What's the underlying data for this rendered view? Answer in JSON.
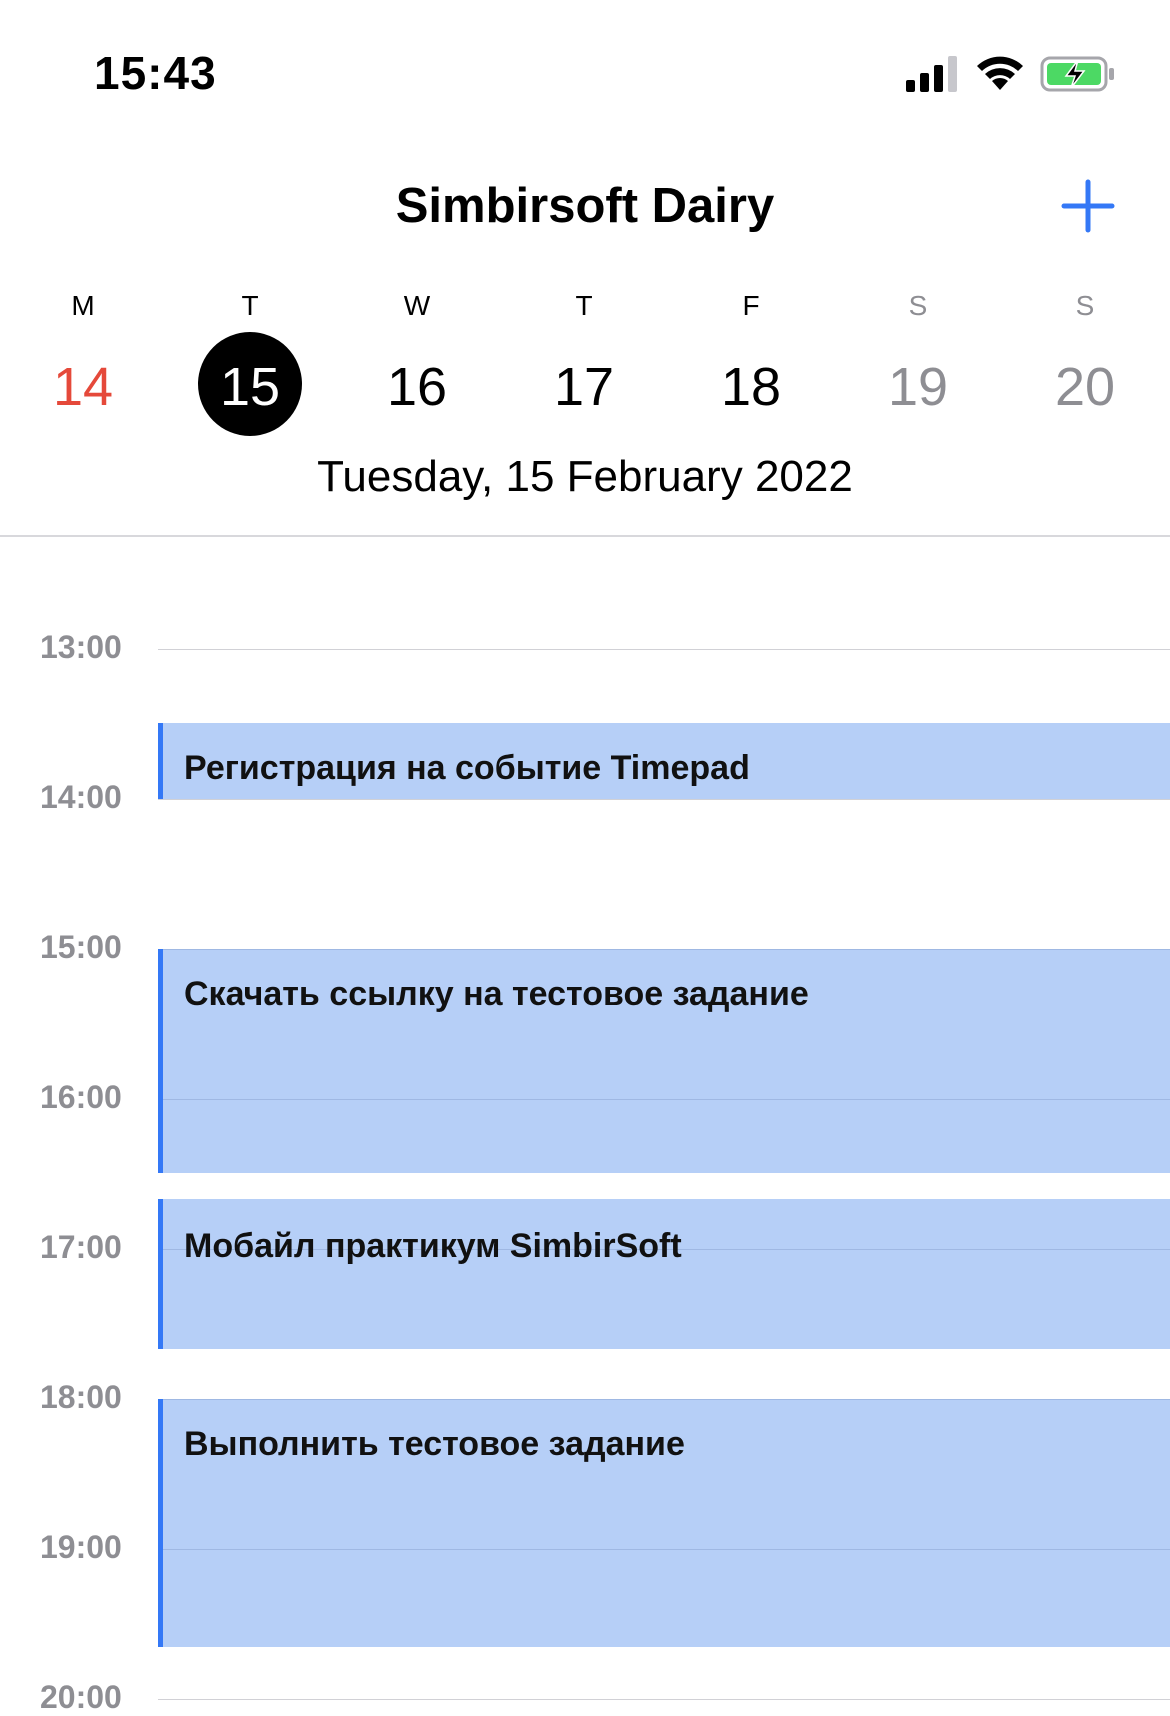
{
  "status_bar": {
    "time": "15:43",
    "icons": [
      "signal-icon",
      "wifi-icon",
      "battery-charging-icon"
    ]
  },
  "nav": {
    "title": "Simbirsoft Dairy",
    "add_icon": "plus-icon"
  },
  "week": {
    "days": [
      {
        "letter": "M",
        "number": "14",
        "state": "today-weekday"
      },
      {
        "letter": "T",
        "number": "15",
        "state": "selected"
      },
      {
        "letter": "W",
        "number": "16",
        "state": "normal"
      },
      {
        "letter": "T",
        "number": "17",
        "state": "normal"
      },
      {
        "letter": "F",
        "number": "18",
        "state": "normal"
      },
      {
        "letter": "S",
        "number": "19",
        "state": "weekend"
      },
      {
        "letter": "S",
        "number": "20",
        "state": "weekend"
      }
    ],
    "selected_date_label": "Tuesday, 15 February 2022"
  },
  "timeline": {
    "hours": [
      "13:00",
      "14:00",
      "15:00",
      "16:00",
      "17:00",
      "18:00",
      "19:00",
      "20:00"
    ],
    "events": [
      {
        "title": "Регистрация на событие Timepad"
      },
      {
        "title": "Скачать ссылку на тестовое задание"
      },
      {
        "title": "Мобайл практикум SimbirSoft"
      },
      {
        "title": "Выполнить тестовое задание"
      }
    ]
  },
  "colors": {
    "accent": "#3478f6",
    "today_red": "#e5493a",
    "weekend_gray": "#8e8e93",
    "event_fill": "#b8d3f8",
    "selected_circle": "#000000"
  }
}
